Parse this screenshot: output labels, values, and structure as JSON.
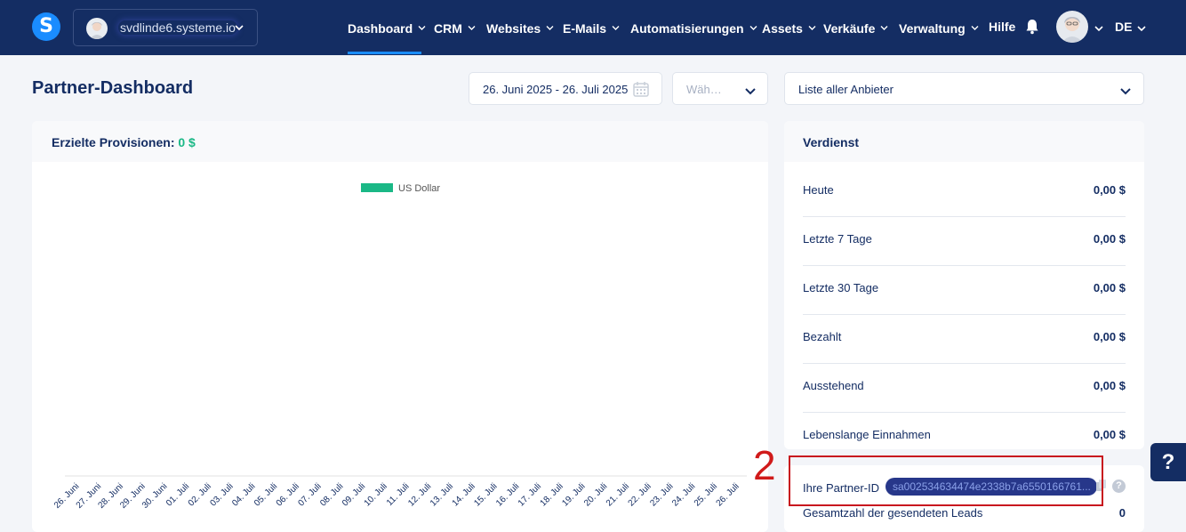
{
  "nav": {
    "logo_letter": "S",
    "account_name": "svdlinde6.systeme.io",
    "items": [
      {
        "label": "Dashboard",
        "has_chevron": true
      },
      {
        "label": "CRM",
        "has_chevron": true
      },
      {
        "label": "Websites",
        "has_chevron": true
      },
      {
        "label": "E-Mails",
        "has_chevron": true
      },
      {
        "label": "Automatisierungen",
        "has_chevron": true
      },
      {
        "label": "Assets",
        "has_chevron": true
      },
      {
        "label": "Verkäufe",
        "has_chevron": true
      },
      {
        "label": "Verwaltung",
        "has_chevron": true
      },
      {
        "label": "Hilfe",
        "has_chevron": false
      }
    ],
    "active": "Dashboard",
    "language": "DE",
    "icons": [
      "bell-icon",
      "user-avatar",
      "chevron-down-icon"
    ]
  },
  "header": {
    "title": "Partner-Dashboard",
    "date_range": "26. Juni 2025 - 26. Juli 2025",
    "select_placeholder": "Wäh…",
    "provider_select": "Liste aller Anbieter"
  },
  "chart_card": {
    "title_prefix": "Erzielte Provisionen:",
    "title_value": "0 $"
  },
  "chart_data": {
    "type": "bar",
    "title": "",
    "legend": [
      "US Dollar"
    ],
    "legend_placement": "top-center",
    "categories": [
      "26. Juni",
      "27. Juni",
      "28. Juni",
      "29. Juni",
      "30. Juni",
      "01. Juli",
      "02. Juli",
      "03. Juli",
      "04. Juli",
      "05. Juli",
      "06. Juli",
      "07. Juli",
      "08. Juli",
      "09. Juli",
      "10. Juli",
      "11. Juli",
      "12. Juli",
      "13. Juli",
      "14. Juli",
      "15. Juli",
      "16. Juli",
      "17. Juli",
      "18. Juli",
      "19. Juli",
      "20. Juli",
      "21. Juli",
      "22. Juli",
      "23. Juli",
      "24. Juli",
      "25. Juli",
      "26. Juli"
    ],
    "series": [
      {
        "name": "US Dollar",
        "values": [
          0,
          0,
          0,
          0,
          0,
          0,
          0,
          0,
          0,
          0,
          0,
          0,
          0,
          0,
          0,
          0,
          0,
          0,
          0,
          0,
          0,
          0,
          0,
          0,
          0,
          0,
          0,
          0,
          0,
          0,
          0
        ]
      }
    ],
    "color": "#1ab886",
    "grid": false,
    "xlabel": "",
    "ylabel": ""
  },
  "earnings": {
    "title": "Verdienst",
    "rows": [
      {
        "label": "Heute",
        "value": "0,00 $"
      },
      {
        "label": "Letzte 7 Tage",
        "value": "0,00 $"
      },
      {
        "label": "Letzte 30 Tage",
        "value": "0,00 $"
      },
      {
        "label": "Bezahlt",
        "value": "0,00 $"
      },
      {
        "label": "Ausstehend",
        "value": "0,00 $"
      },
      {
        "label": "Lebenslange Einnahmen",
        "value": "0,00 $"
      }
    ]
  },
  "partner": {
    "id_label": "Ihre Partner-ID",
    "id_value": "sa002534634474e2338b7a6550166761...",
    "leads_label": "Gesamtzahl der gesendeten Leads",
    "leads_value": "0"
  },
  "annotation": {
    "number": "2"
  },
  "help_button": "?"
}
